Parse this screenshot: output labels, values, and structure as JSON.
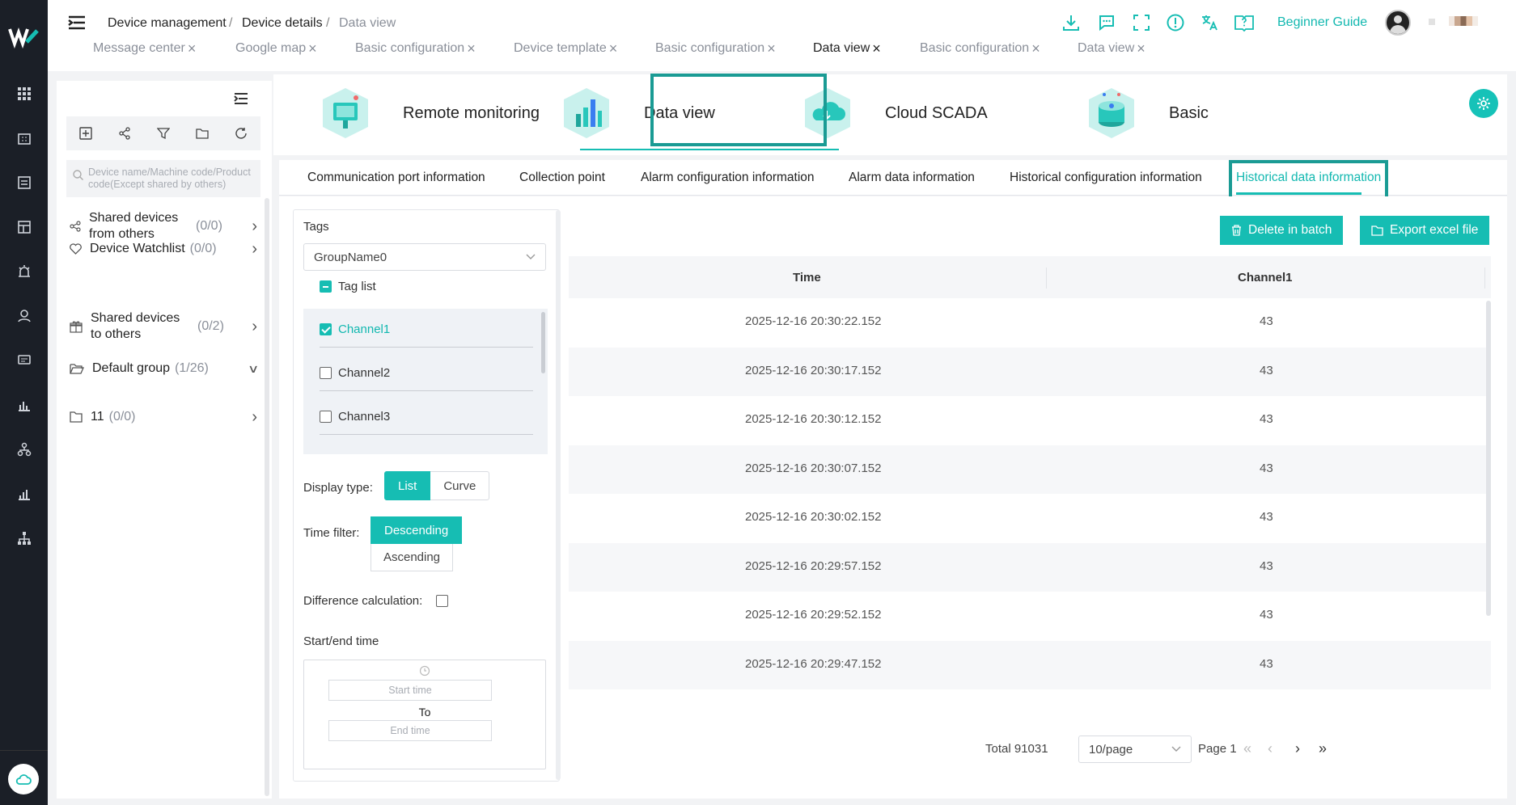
{
  "header": {
    "breadcrumb": [
      "Device management",
      "Device details",
      "Data view"
    ],
    "tabs": [
      "Message center",
      "Google map",
      "Basic configuration",
      "Device template",
      "Basic configuration",
      "Data view",
      "Basic configuration",
      "Data view"
    ],
    "active_tab": "Data view",
    "guide": "Beginner Guide",
    "icons": [
      "download-icon",
      "chat-icon",
      "fullscreen-icon",
      "info-icon",
      "translate-icon",
      "help-book-icon"
    ]
  },
  "rail": {
    "icons": [
      "apps-grid-icon",
      "building-icon",
      "list-icon",
      "dashboard-icon",
      "alarm-icon",
      "user-icon",
      "message-icon",
      "chart-icon",
      "org-icon",
      "stats-icon",
      "network-icon",
      "cloud-icon"
    ]
  },
  "device_panel": {
    "search_placeholder": "Device name/Machine code/Product code(Except shared by others)",
    "items": [
      {
        "label": "Shared devices from others",
        "count": "(0/0)"
      },
      {
        "label": "Device Watchlist",
        "count": "(0/0)"
      },
      {
        "label": "Shared devices to others",
        "count": "(0/2)"
      },
      {
        "label": "Default group",
        "count": "(1/26)"
      },
      {
        "label": "11",
        "count": "(0/0)"
      }
    ]
  },
  "apps": [
    "Remote monitoring",
    "Data view",
    "Cloud SCADA",
    "Basic"
  ],
  "subtabs": [
    "Communication port information",
    "Collection point",
    "Alarm configuration information",
    "Alarm data information",
    "Historical configuration information",
    "Historical data information"
  ],
  "filter": {
    "tags_label": "Tags",
    "group": "GroupName0",
    "tag_list_label": "Tag list",
    "channels": [
      "Channel1",
      "Channel2",
      "Channel3"
    ],
    "display_type_label": "Display type:",
    "display_options": [
      "List",
      "Curve"
    ],
    "time_filter_label": "Time filter:",
    "time_options": [
      "Descending",
      "Ascending"
    ],
    "difference_label": "Difference calculation:",
    "start_end_label": "Start/end time",
    "start_placeholder": "Start time",
    "to": "To",
    "end_placeholder": "End time"
  },
  "actions": {
    "delete": "Delete in batch",
    "export": "Export excel file"
  },
  "table": {
    "columns": [
      "Time",
      "Channel1"
    ],
    "rows": [
      [
        "2025-12-16 20:30:22.152",
        "43"
      ],
      [
        "2025-12-16 20:30:17.152",
        "43"
      ],
      [
        "2025-12-16 20:30:12.152",
        "43"
      ],
      [
        "2025-12-16 20:30:07.152",
        "43"
      ],
      [
        "2025-12-16 20:30:02.152",
        "43"
      ],
      [
        "2025-12-16 20:29:57.152",
        "43"
      ],
      [
        "2025-12-16 20:29:52.152",
        "43"
      ],
      [
        "2025-12-16 20:29:47.152",
        "43"
      ]
    ]
  },
  "pagination": {
    "total": "Total 91031",
    "page_size": "10/page",
    "page": "Page 1"
  },
  "colors": {
    "accent": "#16bdb3",
    "highlight_border": "#1a9b94",
    "rail": "#1b1f27"
  }
}
